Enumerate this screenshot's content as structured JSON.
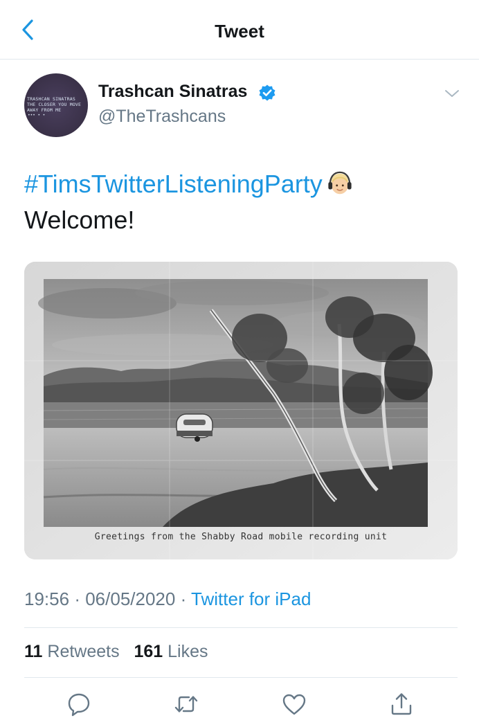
{
  "header": {
    "title": "Tweet",
    "back_icon": "chevron-left-icon"
  },
  "author": {
    "display_name": "Trashcan Sinatras",
    "handle": "@TheTrashcans",
    "verified": true,
    "avatar_text": "TRASHCAN SINATRAS\nTHE CLOSER YOU MOVE\nAWAY FROM ME",
    "avatar_dots": "••• • •"
  },
  "tweet": {
    "hashtag": "#TimsTwitterListeningParty",
    "emoji": "boy-with-headphones-emoji",
    "text": "Welcome!"
  },
  "media": {
    "caption": "Greetings from the Shabby Road mobile recording unit"
  },
  "meta": {
    "time": "19:56",
    "separator": "·",
    "date": "06/05/2020",
    "source": "Twitter for iPad"
  },
  "stats": {
    "retweets_count": "11",
    "retweets_label": "Retweets",
    "likes_count": "161",
    "likes_label": "Likes"
  },
  "actions": [
    "reply-icon",
    "retweet-icon",
    "like-icon",
    "share-icon"
  ],
  "colors": {
    "accent": "#1b95e0",
    "text": "#14171a",
    "secondary": "#657786",
    "divider": "#e1e8ed"
  }
}
